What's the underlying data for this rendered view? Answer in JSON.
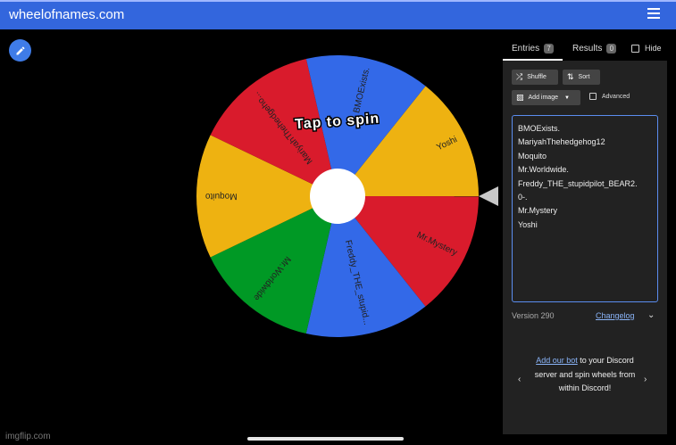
{
  "app": {
    "brand": "wheelofnames.com"
  },
  "wheel": {
    "center_text": "Tap to spin",
    "colors": {
      "red": "#d91b2c",
      "blue": "#3369e8",
      "green": "#009925",
      "yellow": "#eeb211"
    },
    "slices": [
      {
        "label": "Yoshi",
        "color": "#eeb211"
      },
      {
        "label": "Mr.Mystery",
        "color": "#d91b2c"
      },
      {
        "label": "Freddy_THE_stupid...",
        "color": "#3369e8"
      },
      {
        "label": "Mr.Worldwide",
        "color": "#009925"
      },
      {
        "label": "Moquito",
        "color": "#eeb211"
      },
      {
        "label": "MariyahThehedgeho...",
        "color": "#d91b2c"
      },
      {
        "label": "BMOExists.",
        "color": "#3369e8"
      }
    ]
  },
  "panel": {
    "tabs": [
      {
        "label": "Entries",
        "count": "7"
      },
      {
        "label": "Results",
        "count": "0"
      }
    ],
    "hide_label": "Hide",
    "shuffle_label": "Shuffle",
    "sort_label": "Sort",
    "add_image_label": "Add image",
    "advanced_label": "Advanced",
    "entries_lines": [
      "BMOExists.",
      "MariyahThehedgehog12",
      "Moquito",
      "Mr.Worldwide.",
      "Freddy_THE_stupidpilot_BEAR2.",
      "0-.",
      "Mr.Mystery",
      "Yoshi"
    ],
    "version": "Version 290",
    "changelog": "Changelog",
    "discord_link": "Add our bot",
    "discord_text": "to your Discord server and spin wheels from within Discord!"
  },
  "watermark": "imgflip.com"
}
